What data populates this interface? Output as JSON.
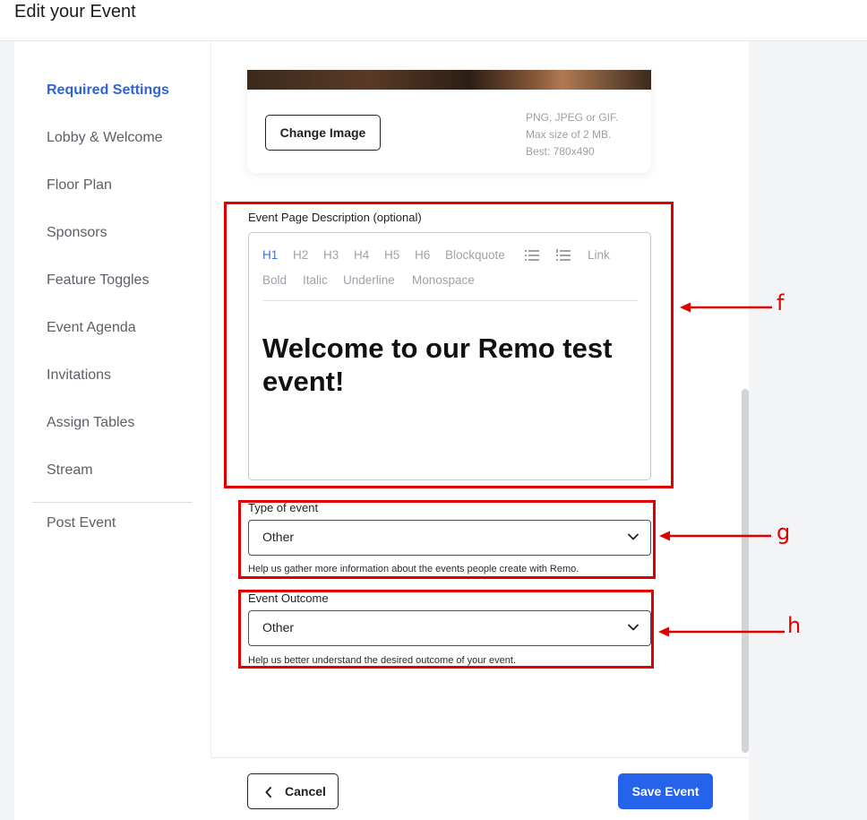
{
  "header": {
    "title": "Edit your Event"
  },
  "sidebar": {
    "items": [
      {
        "label": "Required Settings",
        "active": true
      },
      {
        "label": "Lobby & Welcome",
        "active": false
      },
      {
        "label": "Floor Plan",
        "active": false
      },
      {
        "label": "Sponsors",
        "active": false
      },
      {
        "label": "Feature Toggles",
        "active": false
      },
      {
        "label": "Event Agenda",
        "active": false
      },
      {
        "label": "Invitations",
        "active": false
      },
      {
        "label": "Assign Tables",
        "active": false
      },
      {
        "label": "Stream",
        "active": false
      }
    ],
    "post_event": "Post Event"
  },
  "image_section": {
    "change_button": "Change Image",
    "hints": [
      "PNG, JPEG or GIF.",
      "Max size of 2 MB.",
      "Best: 780x490"
    ]
  },
  "description": {
    "label": "Event Page Description (optional)",
    "toolbar_row1": [
      "H1",
      "H2",
      "H3",
      "H4",
      "H5",
      "H6",
      "Blockquote"
    ],
    "toolbar_link": "Link",
    "toolbar_row2": [
      "Bold",
      "Italic",
      "Underline",
      "Monospace"
    ],
    "active_format": "H1",
    "content": "Welcome to our Remo test event!"
  },
  "type_of_event": {
    "label": "Type of event",
    "value": "Other",
    "helper": "Help us gather more information about the events people create with Remo."
  },
  "event_outcome": {
    "label": "Event Outcome",
    "value": "Other",
    "helper": "Help us better understand the desired outcome of your event."
  },
  "footer": {
    "cancel": "Cancel",
    "save": "Save Event"
  },
  "annotations": {
    "f": "f",
    "g": "g",
    "h": "h"
  },
  "colors": {
    "accent": "#2563eb",
    "active_nav": "#2c63d9",
    "annotation": "#e00000"
  }
}
